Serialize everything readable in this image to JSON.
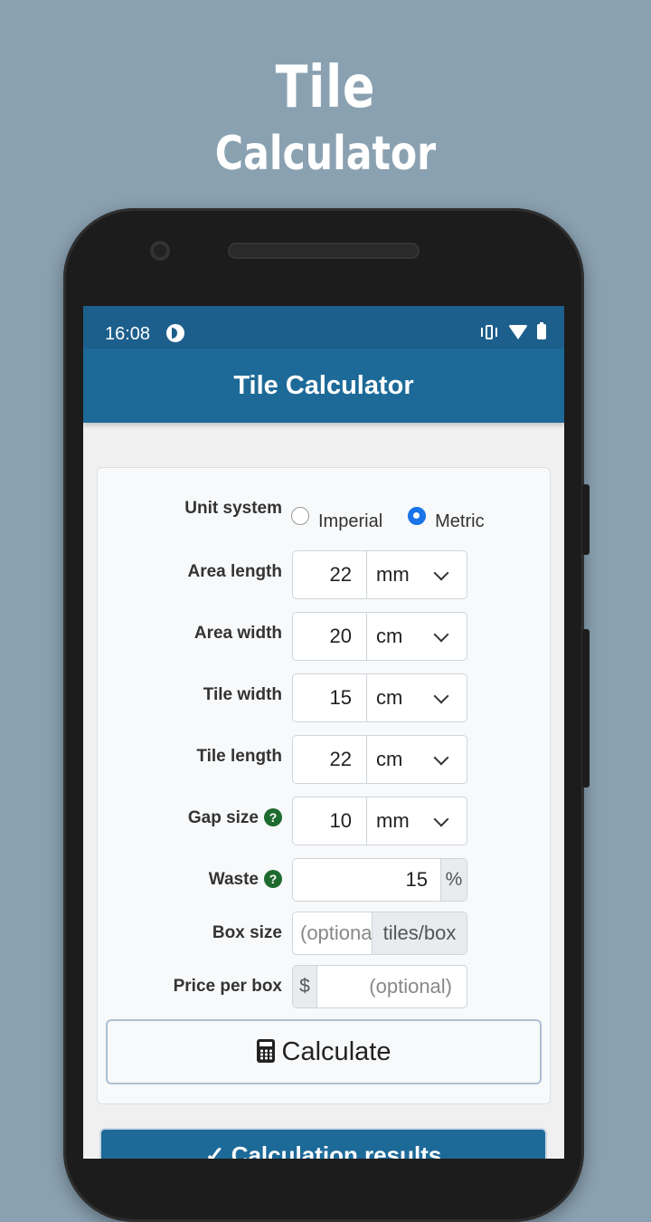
{
  "promo": {
    "line1": "Tile",
    "line2": "Calculator"
  },
  "statusbar": {
    "time": "16:08"
  },
  "appbar": {
    "title": "Tile Calculator"
  },
  "form": {
    "unit_system": {
      "label": "Unit system",
      "options": [
        "Imperial",
        "Metric"
      ],
      "selected": "Metric"
    },
    "area_length": {
      "label": "Area length",
      "value": "22",
      "unit": "mm"
    },
    "area_width": {
      "label": "Area width",
      "value": "20",
      "unit": "cm"
    },
    "tile_width": {
      "label": "Tile width",
      "value": "15",
      "unit": "cm"
    },
    "tile_length": {
      "label": "Tile length",
      "value": "22",
      "unit": "cm"
    },
    "gap_size": {
      "label": "Gap size",
      "value": "10",
      "unit": "mm",
      "help": "?"
    },
    "waste": {
      "label": "Waste",
      "value": "15",
      "addon": "%",
      "help": "?"
    },
    "box_size": {
      "label": "Box size",
      "placeholder": "(optional)",
      "addon": "tiles/box"
    },
    "price_per_box": {
      "label": "Price per box",
      "currency": "$",
      "placeholder": "(optional)"
    }
  },
  "calculate_button": {
    "label": "Calculate"
  },
  "results": {
    "label": "✓ Calculation results"
  },
  "colors": {
    "background": "#8aa1b1",
    "primary": "#1d6a98",
    "help": "#1e6b2f"
  }
}
